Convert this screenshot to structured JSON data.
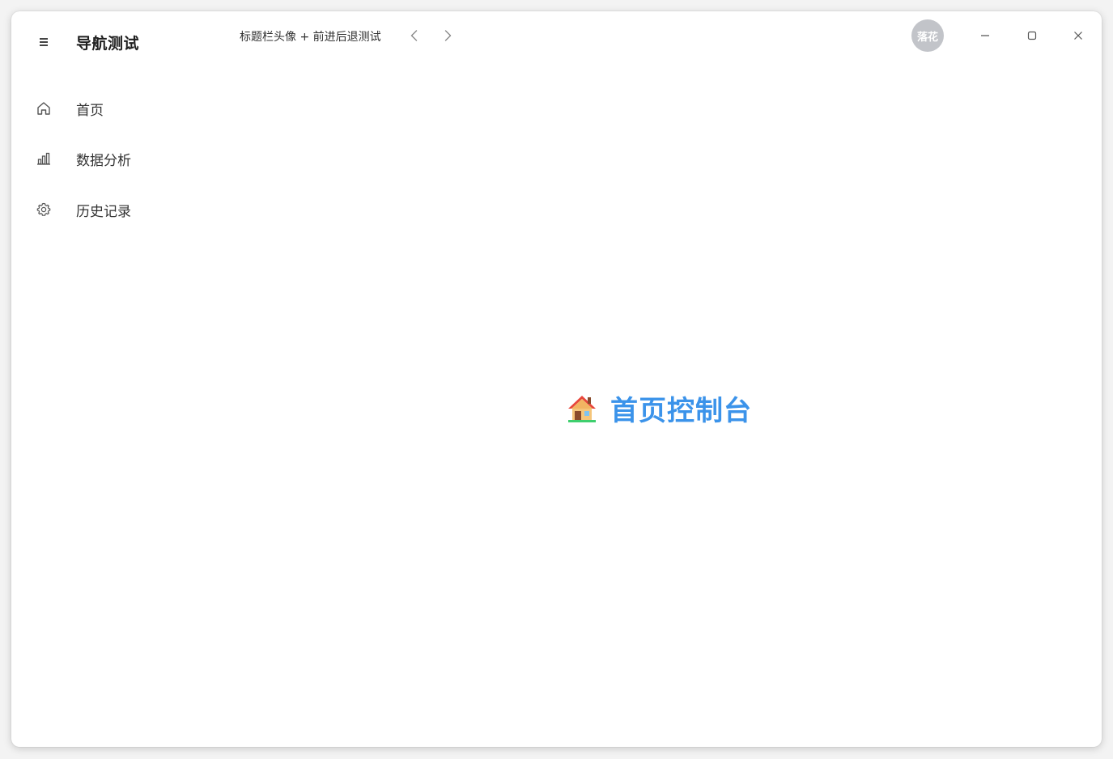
{
  "app": {
    "title": "导航测试"
  },
  "sidebar": {
    "items": [
      {
        "label": "首页",
        "icon": "home-icon"
      },
      {
        "label": "数据分析",
        "icon": "bar-chart-icon"
      },
      {
        "label": "历史记录",
        "icon": "gear-icon"
      }
    ]
  },
  "titlebar": {
    "text": "标题栏头像 + 前进后退测试",
    "avatar_label": "落花"
  },
  "main": {
    "heading": "首页控制台",
    "heading_icon": "house-icon",
    "accent_color": "#3b93ea"
  },
  "colors": {
    "avatar_bg": "#c2c4c9",
    "text": "#333333"
  }
}
